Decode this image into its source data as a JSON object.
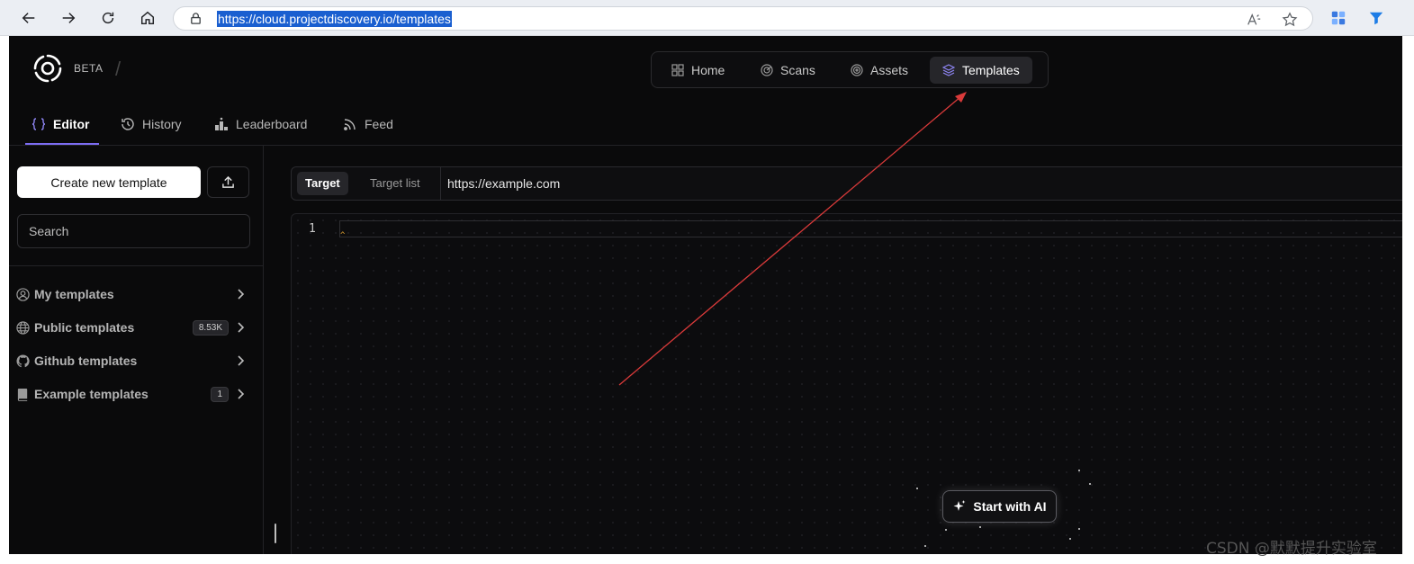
{
  "browser": {
    "url": "https://cloud.projectdiscovery.io/templates",
    "icons": [
      "back-icon",
      "forward-icon",
      "refresh-icon",
      "home-icon",
      "lock-icon",
      "read-aloud-icon",
      "favorite-icon",
      "extensions-icon",
      "filter-icon"
    ]
  },
  "header": {
    "beta_label": "BETA",
    "slash": "/",
    "topnav": [
      {
        "label": "Home",
        "icon": "grid-icon"
      },
      {
        "label": "Scans",
        "icon": "radar-icon"
      },
      {
        "label": "Assets",
        "icon": "target-icon"
      },
      {
        "label": "Templates",
        "icon": "layers-icon",
        "active": true
      }
    ]
  },
  "subnav": [
    {
      "label": "Editor",
      "icon": "braces-icon",
      "active": true
    },
    {
      "label": "History",
      "icon": "history-icon"
    },
    {
      "label": "Leaderboard",
      "icon": "podium-icon"
    },
    {
      "label": "Feed",
      "icon": "rss-icon"
    }
  ],
  "sidebar": {
    "create_label": "Create new template",
    "search_placeholder": "Search",
    "items": [
      {
        "label": "My templates",
        "icon": "user-circle-icon",
        "badge": ""
      },
      {
        "label": "Public templates",
        "icon": "globe-icon",
        "badge": "8.53K"
      },
      {
        "label": "Github templates",
        "icon": "github-icon",
        "badge": ""
      },
      {
        "label": "Example templates",
        "icon": "book-icon",
        "badge": "1"
      }
    ]
  },
  "target": {
    "tabs": [
      "Target",
      "Target list"
    ],
    "url": "https://example.com"
  },
  "editor": {
    "line_number": "1",
    "ai_button": "Start with AI"
  },
  "watermark": "CSDN @默默提升实验室",
  "colors": {
    "accent": "#7c6cf2",
    "background": "#0a0a0b",
    "annotation_arrow": "#d93a3a"
  }
}
